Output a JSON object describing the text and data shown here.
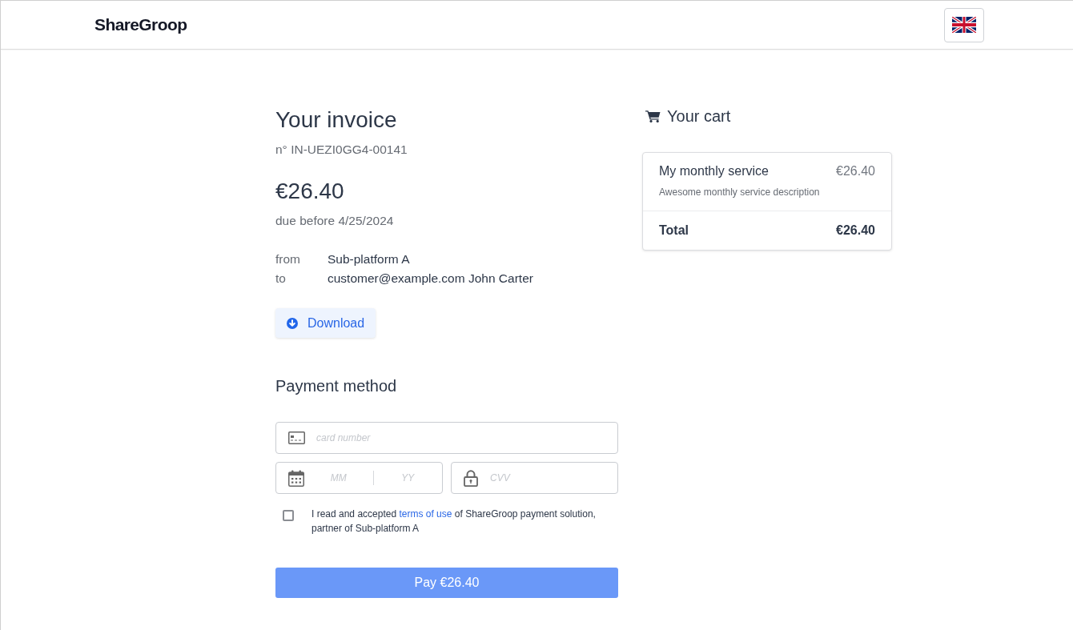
{
  "header": {
    "logo": "ShareGroop"
  },
  "invoice": {
    "title": "Your invoice",
    "number": "n° IN-UEZI0GG4-00141",
    "amount": "€26.40",
    "due": "due before 4/25/2024",
    "parties": [
      {
        "label": "from",
        "value": "Sub-platform A"
      },
      {
        "label": "to",
        "value": "customer@example.com John Carter"
      }
    ],
    "download_button": "Download"
  },
  "payment": {
    "title": "Payment method",
    "fields": [
      {
        "kind": "card_number",
        "placeholder": "card number"
      },
      {
        "kind": "expiry",
        "parts": [
          {
            "placeholder": "MM"
          },
          {
            "placeholder": "YY"
          }
        ]
      },
      {
        "kind": "cvv",
        "placeholder": "CVV"
      }
    ],
    "terms": {
      "checked": false,
      "text_before": "I read and accepted ",
      "link": "terms of use",
      "text_after": " of ShareGroop payment solution, partner of Sub-platform A"
    },
    "pay_button": "Pay €26.40"
  },
  "cart": {
    "title": "Your cart",
    "items": [
      {
        "name": "My monthly service",
        "price": "€26.40",
        "description": "Awesome monthly service description"
      }
    ],
    "total_label": "Total",
    "total_value": "€26.40"
  }
}
